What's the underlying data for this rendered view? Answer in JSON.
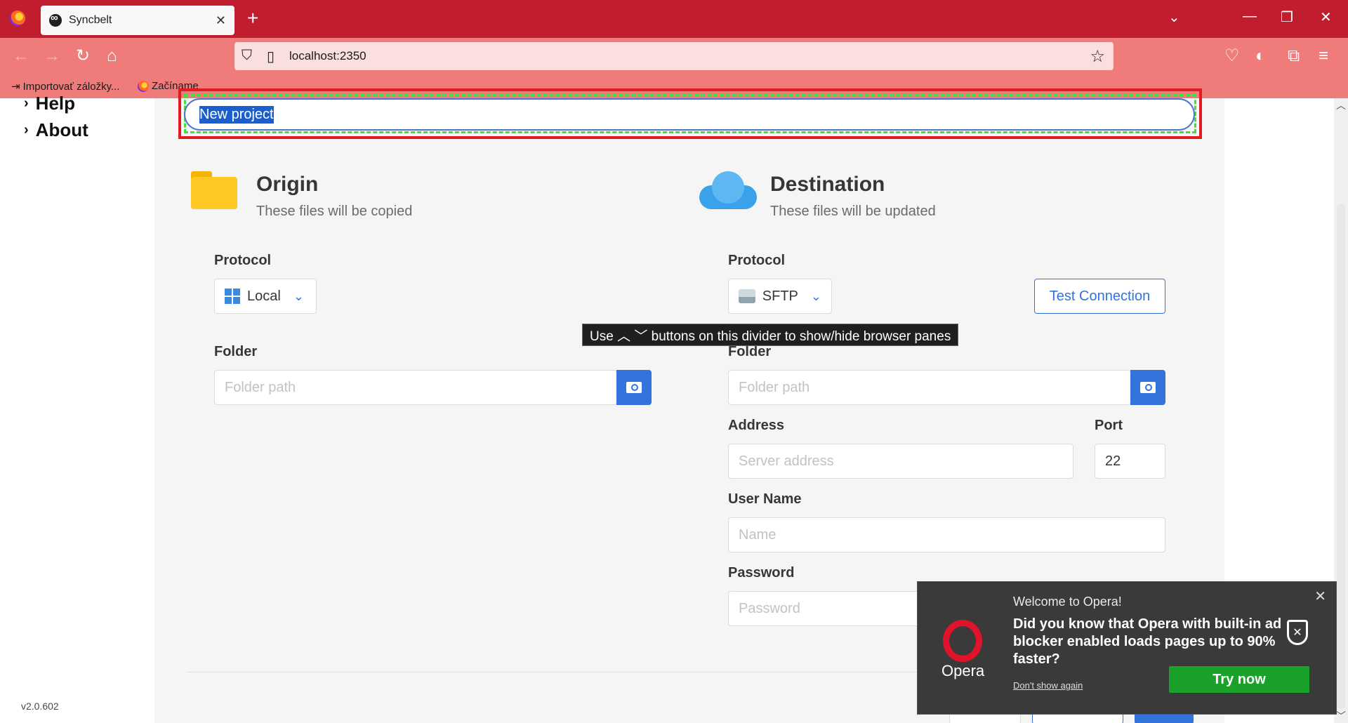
{
  "browser": {
    "tab_title": "Syncbelt",
    "tab_close": "✕",
    "new_tab": "+",
    "url": "localhost:2350",
    "bookmarks": [
      "Importovať záložky...",
      "Začíname"
    ]
  },
  "sidebar": {
    "items": [
      {
        "label": "Help"
      },
      {
        "label": "About"
      }
    ],
    "version": "v2.0.602"
  },
  "project": {
    "name": "New project"
  },
  "origin": {
    "title": "Origin",
    "subtitle": "These files will be copied",
    "protocol_label": "Protocol",
    "protocol_value": "Local",
    "folder_label": "Folder",
    "folder_placeholder": "Folder path"
  },
  "destination": {
    "title": "Destination",
    "subtitle": "These files will be updated",
    "protocol_label": "Protocol",
    "protocol_value": "SFTP",
    "test_connection": "Test Connection",
    "folder_label": "Folder",
    "folder_placeholder": "Folder path",
    "address_label": "Address",
    "address_placeholder": "Server address",
    "port_label": "Port",
    "port_value": "22",
    "username_label": "User Name",
    "username_placeholder": "Name",
    "password_label": "Password",
    "password_placeholder": "Password"
  },
  "tooltip": "Use ︿ ﹀ buttons on this divider to show/hide browser panes",
  "opera": {
    "brand": "Opera",
    "welcome": "Welcome to Opera!",
    "message": "Did you know that Opera with built-in ad blocker enabled loads pages up to 90% faster?",
    "dont_show": "Don't show again",
    "try_now": "Try now"
  },
  "colors": {
    "browser_tabbar": "#c01d2f",
    "browser_navbar": "#ef7b7b",
    "accent": "#3273dc",
    "opera_green": "#19a12a"
  }
}
